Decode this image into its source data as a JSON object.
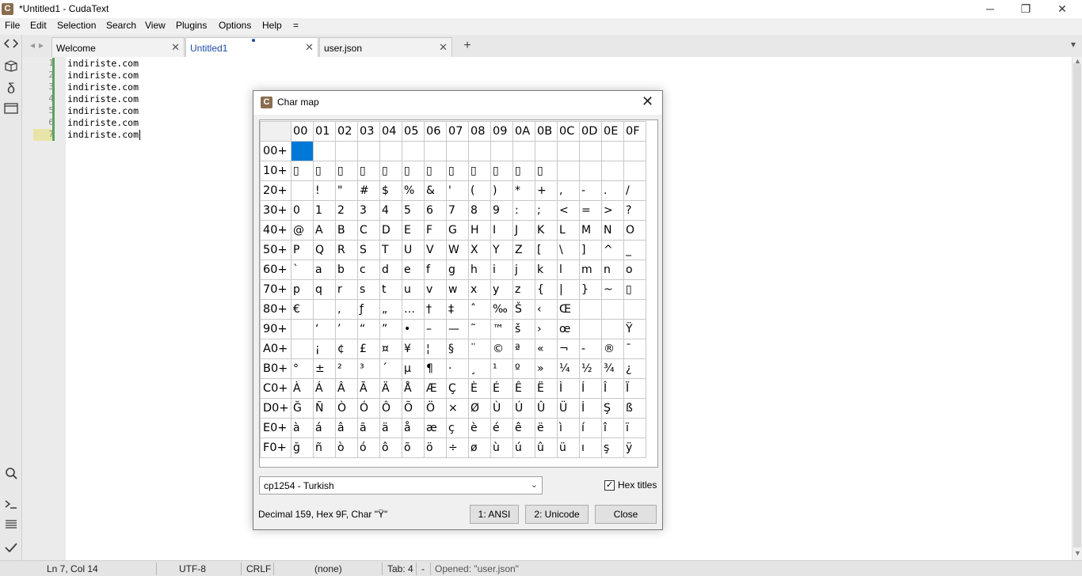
{
  "window": {
    "title": "*Untitled1 - CudaText",
    "app_icon": "C",
    "minimize_glyph": "─",
    "restore_glyph": "❐",
    "close_glyph": "✕"
  },
  "menu": {
    "file": "File",
    "edit": "Edit",
    "selection": "Selection",
    "search": "Search",
    "view": "View",
    "plugins": "Plugins",
    "options": "Options",
    "help": "Help",
    "extra": "="
  },
  "tabs": [
    {
      "label": "Welcome",
      "close": "✕"
    },
    {
      "label": "Untitled1",
      "close": "✕"
    },
    {
      "label": "user.json",
      "close": "✕"
    }
  ],
  "tabbar": {
    "add": "+",
    "left_arrow": "◂",
    "right_arrow": "▸",
    "menu": "▾"
  },
  "editor": {
    "line_numbers": [
      "1",
      "2",
      "3",
      "4",
      "5",
      "6",
      "7"
    ],
    "lines": [
      "indiriste.com",
      "indiriste.com",
      "indiriste.com",
      "indiriste.com",
      "indiriste.com",
      "indiriste.com",
      "indiriste.com"
    ]
  },
  "sidebar": {
    "icons": [
      "code-tree-icon",
      "project-icon",
      "snippets-icon",
      "tabs-list-icon",
      "search-icon",
      "console-icon",
      "output-icon",
      "validate-icon"
    ]
  },
  "statusbar": {
    "position": "Ln 7, Col 14",
    "encoding": "UTF-8",
    "line_ending": "CRLF",
    "lexer": "(none)",
    "tab_size": "Tab: 4",
    "dash": "-",
    "message": "Opened: \"user.json\""
  },
  "dialog": {
    "title": "Char map",
    "icon": "C",
    "close_glyph": "✕",
    "col_headers": [
      "00",
      "01",
      "02",
      "03",
      "04",
      "05",
      "06",
      "07",
      "08",
      "09",
      "0A",
      "0B",
      "0C",
      "0D",
      "0E",
      "0F"
    ],
    "rows": [
      {
        "h": "00+",
        "c": [
          "",
          "",
          "",
          "",
          "",
          "",
          "",
          "",
          "",
          "",
          "",
          "",
          "",
          "",
          "",
          ""
        ]
      },
      {
        "h": "10+",
        "c": [
          "▯",
          "▯",
          "▯",
          "▯",
          "▯",
          "▯",
          "▯",
          "▯",
          "▯",
          "▯",
          "▯",
          "▯",
          "",
          "",
          "",
          ""
        ]
      },
      {
        "h": "20+",
        "c": [
          "",
          "!",
          "\"",
          "#",
          "$",
          "%",
          "&",
          "'",
          "(",
          ")",
          "*",
          "+",
          ",",
          "-",
          ".",
          "/"
        ]
      },
      {
        "h": "30+",
        "c": [
          "0",
          "1",
          "2",
          "3",
          "4",
          "5",
          "6",
          "7",
          "8",
          "9",
          ":",
          ";",
          "<",
          "=",
          ">",
          "?"
        ]
      },
      {
        "h": "40+",
        "c": [
          "@",
          "A",
          "B",
          "C",
          "D",
          "E",
          "F",
          "G",
          "H",
          "I",
          "J",
          "K",
          "L",
          "M",
          "N",
          "O"
        ]
      },
      {
        "h": "50+",
        "c": [
          "P",
          "Q",
          "R",
          "S",
          "T",
          "U",
          "V",
          "W",
          "X",
          "Y",
          "Z",
          "[",
          "\\",
          "]",
          "^",
          "_"
        ]
      },
      {
        "h": "60+",
        "c": [
          "`",
          "a",
          "b",
          "c",
          "d",
          "e",
          "f",
          "g",
          "h",
          "i",
          "j",
          "k",
          "l",
          "m",
          "n",
          "o"
        ]
      },
      {
        "h": "70+",
        "c": [
          "p",
          "q",
          "r",
          "s",
          "t",
          "u",
          "v",
          "w",
          "x",
          "y",
          "z",
          "{",
          "|",
          "}",
          "~",
          "▯"
        ]
      },
      {
        "h": "80+",
        "c": [
          "€",
          "",
          "‚",
          "ƒ",
          "„",
          "…",
          "†",
          "‡",
          "ˆ",
          "‰",
          "Š",
          "‹",
          "Œ",
          "",
          "",
          ""
        ]
      },
      {
        "h": "90+",
        "c": [
          "",
          "‘",
          "’",
          "“",
          "”",
          "•",
          "–",
          "—",
          "˜",
          "™",
          "š",
          "›",
          "œ",
          "",
          "",
          "Ÿ"
        ]
      },
      {
        "h": "A0+",
        "c": [
          "",
          "¡",
          "¢",
          "£",
          "¤",
          "¥",
          "¦",
          "§",
          "¨",
          "©",
          "ª",
          "«",
          "¬",
          "-",
          "®",
          "¯"
        ]
      },
      {
        "h": "B0+",
        "c": [
          "°",
          "±",
          "²",
          "³",
          "´",
          "µ",
          "¶",
          "·",
          "¸",
          "¹",
          "º",
          "»",
          "¼",
          "½",
          "¾",
          "¿"
        ]
      },
      {
        "h": "C0+",
        "c": [
          "À",
          "Á",
          "Â",
          "Ã",
          "Ä",
          "Å",
          "Æ",
          "Ç",
          "È",
          "É",
          "Ê",
          "Ë",
          "Ì",
          "Í",
          "Î",
          "Ï"
        ]
      },
      {
        "h": "D0+",
        "c": [
          "Ğ",
          "Ñ",
          "Ò",
          "Ó",
          "Ô",
          "Õ",
          "Ö",
          "×",
          "Ø",
          "Ù",
          "Ú",
          "Û",
          "Ü",
          "İ",
          "Ş",
          "ß"
        ]
      },
      {
        "h": "E0+",
        "c": [
          "à",
          "á",
          "â",
          "ã",
          "ä",
          "å",
          "æ",
          "ç",
          "è",
          "é",
          "ê",
          "ë",
          "ì",
          "í",
          "î",
          "ï"
        ]
      },
      {
        "h": "F0+",
        "c": [
          "ğ",
          "ñ",
          "ò",
          "ó",
          "ô",
          "õ",
          "ö",
          "÷",
          "ø",
          "ù",
          "ú",
          "û",
          "ü",
          "ı",
          "ş",
          "ÿ"
        ]
      }
    ],
    "codepage": "cp1254 - Turkish",
    "hex_titles_label": "Hex titles",
    "hex_titles_checked": "✓",
    "info": "Decimal 159, Hex 9F, Char \"Ÿ\"",
    "btn_ansi": "1: ANSI",
    "btn_unicode": "2: Unicode",
    "btn_close": "Close",
    "dropdown_arrow": "⌄"
  }
}
